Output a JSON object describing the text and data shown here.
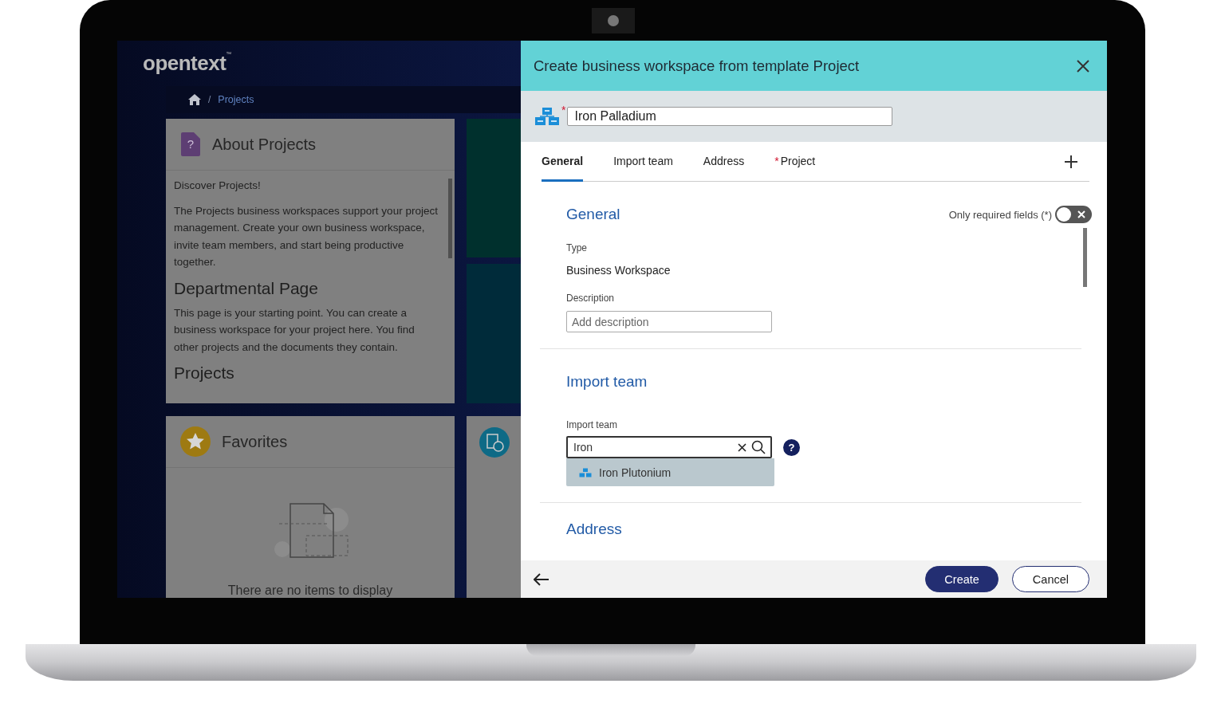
{
  "app": {
    "logo": "opentext",
    "logo_mark": "™",
    "breadcrumb_separator": "/",
    "breadcrumb": [
      "Projects"
    ],
    "about": {
      "title": "About Projects",
      "icon_glyph": "?",
      "blocks": [
        {
          "kind": "text",
          "text": "Discover Projects!"
        },
        {
          "kind": "text",
          "text": "The Projects business workspaces support your project management. Create your own business workspace, invite team members, and start being productive together."
        },
        {
          "kind": "heading",
          "text": "Departmental Page"
        },
        {
          "kind": "text",
          "text": "This page is your starting point. You can create a business workspace for your project here. You find other projects and the documents they contain."
        },
        {
          "kind": "heading",
          "text": "Projects"
        }
      ]
    },
    "favorites": {
      "title": "Favorites",
      "empty_text": "There are no items to display"
    }
  },
  "dialog": {
    "title": "Create business workspace from template Project",
    "required_mark": "*",
    "name": {
      "value": "Iron Palladium",
      "required": true
    },
    "tabs": [
      {
        "label": "General",
        "selected": true,
        "required": false
      },
      {
        "label": "Import team",
        "selected": false,
        "required": false
      },
      {
        "label": "Address",
        "selected": false,
        "required": false
      },
      {
        "label": "Project",
        "selected": false,
        "required": true
      }
    ],
    "required_only": {
      "label": "Only required fields (*)",
      "on": false
    },
    "general": {
      "heading": "General",
      "type_label": "Type",
      "type_value": "Business Workspace",
      "description_label": "Description",
      "description_placeholder": "Add description"
    },
    "import_team": {
      "heading": "Import team",
      "field_label": "Import team",
      "value": "Iron",
      "help_glyph": "?",
      "suggestions": [
        "Iron Plutonium"
      ]
    },
    "address": {
      "heading": "Address"
    },
    "buttons": [
      {
        "label": "Create",
        "kind": "primary"
      },
      {
        "label": "Cancel",
        "kind": "secondary"
      }
    ]
  }
}
